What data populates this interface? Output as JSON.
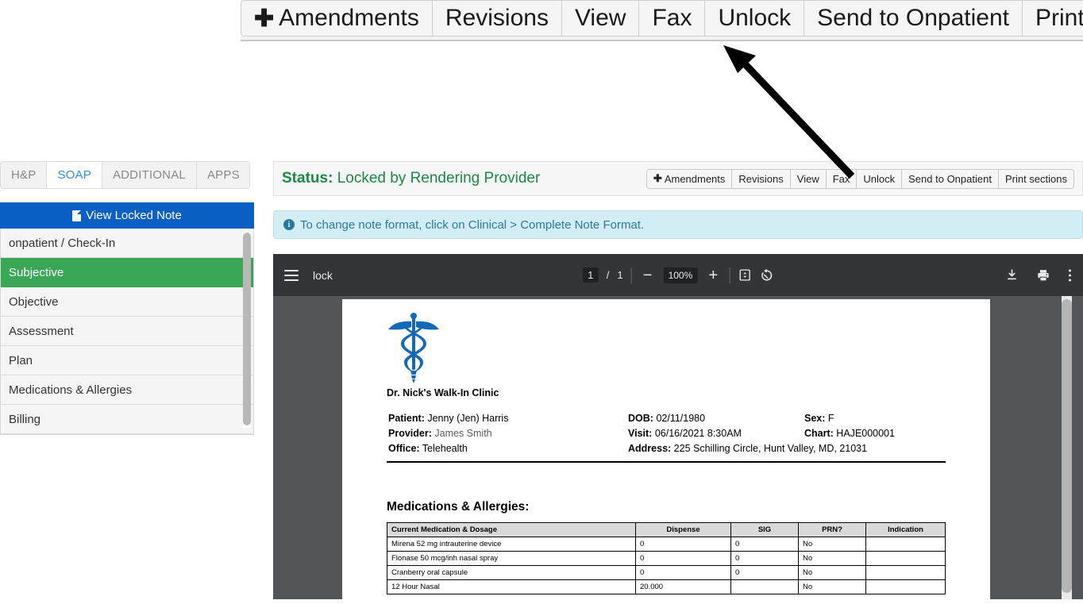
{
  "magnifier": {
    "buttons": [
      {
        "label": "Amendments",
        "has_plus": true
      },
      {
        "label": "Revisions",
        "has_plus": false
      },
      {
        "label": "View",
        "has_plus": false
      },
      {
        "label": "Fax",
        "has_plus": false
      },
      {
        "label": "Unlock",
        "has_plus": false
      },
      {
        "label": "Send to Onpatient",
        "has_plus": false
      },
      {
        "label": "Print sections",
        "has_plus": false
      }
    ]
  },
  "tabs": [
    {
      "label": "H&P",
      "active": false
    },
    {
      "label": "SOAP",
      "active": true
    },
    {
      "label": "ADDITIONAL",
      "active": false
    },
    {
      "label": "APPS",
      "active": false
    }
  ],
  "sidebar": {
    "view_locked_note": "View Locked Note",
    "items": [
      {
        "label": "onpatient / Check-In",
        "selected": false
      },
      {
        "label": "Subjective",
        "selected": true
      },
      {
        "label": "Objective",
        "selected": false
      },
      {
        "label": "Assessment",
        "selected": false
      },
      {
        "label": "Plan",
        "selected": false
      },
      {
        "label": "Medications & Allergies",
        "selected": false
      },
      {
        "label": "Billing",
        "selected": false
      }
    ]
  },
  "status": {
    "label": "Status:",
    "value": "Locked by Rendering Provider",
    "color": "#1a8a44"
  },
  "toolbar": {
    "buttons": [
      {
        "label": "Amendments",
        "has_plus": true
      },
      {
        "label": "Revisions",
        "has_plus": false
      },
      {
        "label": "View",
        "has_plus": false
      },
      {
        "label": "Fax",
        "has_plus": false
      },
      {
        "label": "Unlock",
        "has_plus": false
      },
      {
        "label": "Send to Onpatient",
        "has_plus": false
      },
      {
        "label": "Print sections",
        "has_plus": false
      }
    ]
  },
  "info_banner": {
    "text": "To change note format, click on Clinical > Complete Note Format.",
    "icon": "info-icon"
  },
  "pdf_viewer": {
    "filename": "lock",
    "current_page": "1",
    "page_separator": "/",
    "total_pages": "1",
    "zoom_level": "100%",
    "zoom_out": "−",
    "zoom_in": "+",
    "icons": [
      "menu-icon",
      "fit-page-icon",
      "rotate-icon",
      "download-icon",
      "print-icon",
      "more-options-icon"
    ]
  },
  "document": {
    "logo": "caduceus-logo",
    "clinic_name": "Dr. Nick's Walk-In Clinic",
    "fields": [
      {
        "label": "Patient:",
        "value": "Jenny (Jen) Harris"
      },
      {
        "label": "Provider:",
        "value": "James Smith"
      },
      {
        "label": "Office:",
        "value": "Telehealth"
      }
    ],
    "fields_mid": [
      {
        "label": "DOB:",
        "value": "02/11/1980"
      },
      {
        "label": "Visit:",
        "value": "06/16/2021 8:30AM"
      },
      {
        "label": "Address:",
        "value": "225 Schilling Circle, Hunt Valley, MD, 21031"
      }
    ],
    "fields_right": [
      {
        "label": "Sex:",
        "value": "F"
      },
      {
        "label": "Chart:",
        "value": "HAJE000001"
      }
    ],
    "section_title": "Medications & Allergies:",
    "table": {
      "headers": [
        "Current Medication & Dosage",
        "Dispense",
        "SIG",
        "PRN?",
        "Indication"
      ],
      "rows": [
        [
          "Mirena 52 mg intrauterine device",
          "0",
          "0",
          "No",
          ""
        ],
        [
          "Flonase 50 mcg/inh nasal spray",
          "0",
          "0",
          "No",
          ""
        ],
        [
          "Cranberry oral capsule",
          "0",
          "0",
          "No",
          ""
        ],
        [
          "12 Hour Nasal",
          "20.000",
          "",
          "No",
          ""
        ]
      ]
    }
  }
}
